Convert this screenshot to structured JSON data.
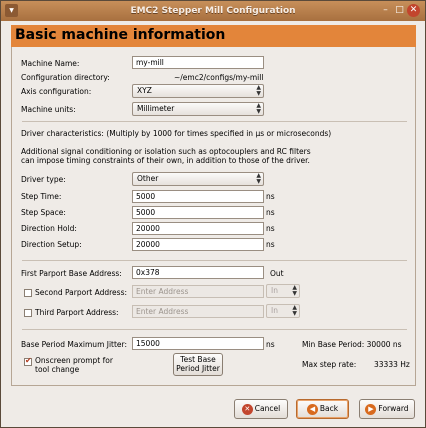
{
  "window": {
    "title": "EMC2 Stepper Mill Configuration"
  },
  "header": {
    "title": "Basic machine information"
  },
  "basic": {
    "machine_name_label": "Machine Name:",
    "machine_name_value": "my-mill",
    "config_dir_label": "Configuration directory:",
    "config_dir_value": "~/emc2/configs/my-mill",
    "axis_config_label": "Axis configuration:",
    "axis_config_value": "XYZ",
    "machine_units_label": "Machine units:",
    "machine_units_value": "Millimeter"
  },
  "driver": {
    "characteristics_text": "Driver characteristics: (Multiply by 1000 for times specified in µs or microseconds)",
    "note_line1": "Additional signal conditioning or isolation such as optocouplers and RC filters",
    "note_line2": "can impose timing constraints of their own, in addition to those of the driver.",
    "driver_type_label": "Driver type:",
    "driver_type_value": "Other",
    "step_time_label": "Step Time:",
    "step_time_value": "5000",
    "step_space_label": "Step Space:",
    "step_space_value": "5000",
    "dir_hold_label": "Direction Hold:",
    "dir_hold_value": "20000",
    "dir_setup_label": "Direction Setup:",
    "dir_setup_value": "20000",
    "unit_ns": "ns"
  },
  "parport": {
    "first_label": "First Parport Base Address:",
    "first_value": "0x378",
    "first_dir": "Out",
    "second_label": "Second Parport Address:",
    "second_placeholder": "Enter Address",
    "second_dir": "In",
    "third_label": "Third Parport Address:",
    "third_placeholder": "Enter Address",
    "third_dir": "In"
  },
  "timing": {
    "base_period_label": "Base Period Maximum Jitter:",
    "base_period_value": "15000",
    "unit_ns": "ns",
    "min_base_period": "Min Base Period: 30000 ns",
    "onscreen_prompt_line1": "Onscreen prompt for",
    "onscreen_prompt_line2": "tool change",
    "test_button_line1": "Test Base",
    "test_button_line2": "Period Jitter",
    "max_step_rate_label": "Max step rate:",
    "max_step_rate_value": "33333 Hz"
  },
  "buttons": {
    "cancel": "Cancel",
    "back": "Back",
    "forward": "Forward"
  },
  "colors": {
    "accent": "#e3853a",
    "titlebar": "#b57c4a",
    "cancel_icon": "#c2452d"
  }
}
